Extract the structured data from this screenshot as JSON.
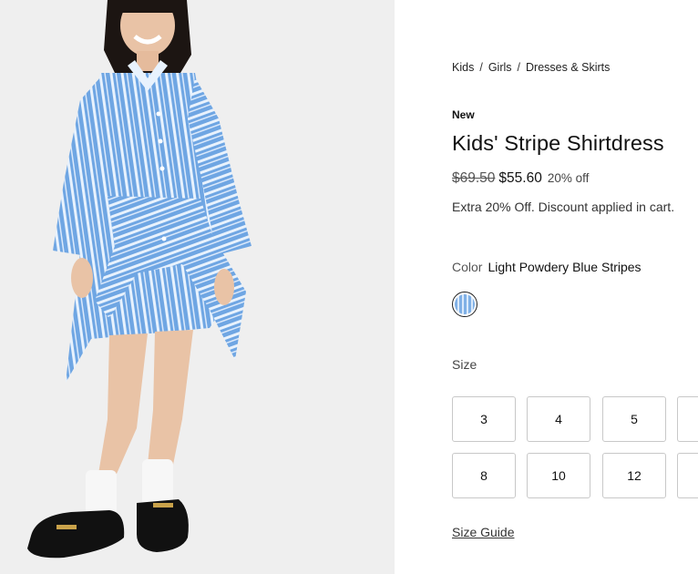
{
  "product_image": {
    "alt": "Kids' Stripe Shirtdress"
  },
  "breadcrumb": {
    "items": [
      "Kids",
      "Girls",
      "Dresses & Skirts"
    ],
    "separator": "/"
  },
  "badge": "New",
  "product": {
    "title": "Kids' Stripe Shirtdress",
    "original_price": "$69.50",
    "sale_price": "$55.60",
    "discount": "20% off",
    "promo": "Extra 20% Off. Discount applied in cart."
  },
  "color": {
    "label": "Color",
    "selected": "Light Powdery Blue Stripes",
    "swatch_colors": [
      "#7fb0e6",
      "#d9e9fb"
    ]
  },
  "size": {
    "label": "Size",
    "options": [
      "3",
      "4",
      "5",
      "",
      "8",
      "10",
      "12",
      ""
    ]
  },
  "size_guide": "Size Guide"
}
